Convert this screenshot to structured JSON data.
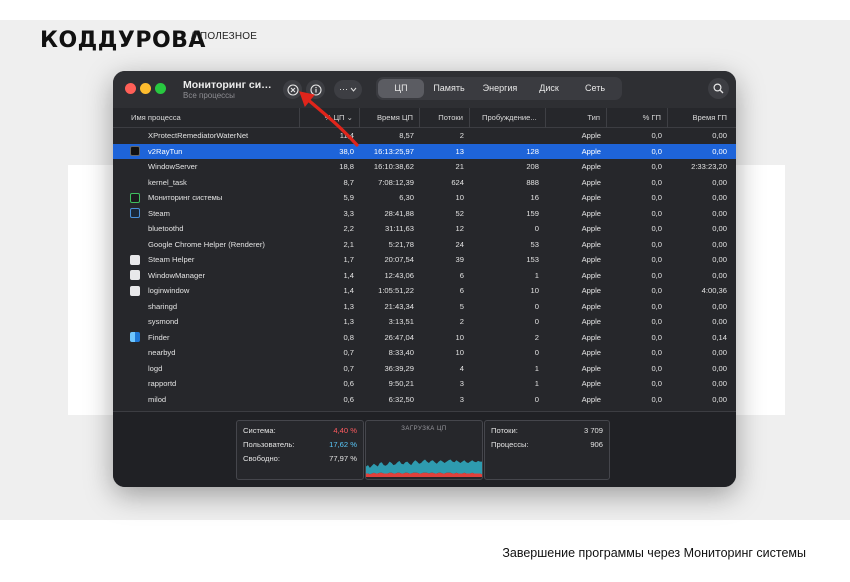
{
  "page": {
    "logo": "КОДДУРОВА",
    "logo_sub": "// ПОЛЕЗНОЕ",
    "caption": "Завершение программы через Мониторинг системы"
  },
  "window": {
    "title": "Мониторинг систе...",
    "subtitle": "Все процессы",
    "more_label": "⋯",
    "tabs": [
      {
        "label": "ЦП",
        "active": true
      },
      {
        "label": "Память",
        "active": false
      },
      {
        "label": "Энергия",
        "active": false
      },
      {
        "label": "Диск",
        "active": false
      },
      {
        "label": "Сеть",
        "active": false
      }
    ],
    "columns": [
      "Имя процесса",
      "% ЦП ⌄",
      "Время ЦП",
      "Потоки",
      "Пробуждение...",
      "Тип",
      "% ГП",
      "Время ГП"
    ]
  },
  "processes": [
    {
      "name": "XProtectRemediatorWaterNet",
      "cpu": "11,4",
      "time": "8,57",
      "threads": "2",
      "wakeups": "",
      "type": "Apple",
      "gpu": "0,0",
      "gpu_time": "0,00",
      "icon": "none"
    },
    {
      "name": "v2RayTun",
      "cpu": "38,0",
      "time": "16:13:25,97",
      "threads": "13",
      "wakeups": "128",
      "type": "Apple",
      "gpu": "0,0",
      "gpu_time": "0,00",
      "icon": "v2raytun-icon",
      "selected": true
    },
    {
      "name": "WindowServer",
      "cpu": "18,8",
      "time": "16:10:38,62",
      "threads": "21",
      "wakeups": "208",
      "type": "Apple",
      "gpu": "0,0",
      "gpu_time": "2:33:23,20",
      "icon": "none"
    },
    {
      "name": "kernel_task",
      "cpu": "8,7",
      "time": "7:08:12,39",
      "threads": "624",
      "wakeups": "888",
      "type": "Apple",
      "gpu": "0,0",
      "gpu_time": "0,00",
      "icon": "none"
    },
    {
      "name": "Мониторинг системы",
      "cpu": "5,9",
      "time": "6,30",
      "threads": "10",
      "wakeups": "16",
      "type": "Apple",
      "gpu": "0,0",
      "gpu_time": "0,00",
      "icon": "activity-monitor-icon"
    },
    {
      "name": "Steam",
      "cpu": "3,3",
      "time": "28:41,88",
      "threads": "52",
      "wakeups": "159",
      "type": "Apple",
      "gpu": "0,0",
      "gpu_time": "0,00",
      "icon": "steam-icon"
    },
    {
      "name": "bluetoothd",
      "cpu": "2,2",
      "time": "31:11,63",
      "threads": "12",
      "wakeups": "0",
      "type": "Apple",
      "gpu": "0,0",
      "gpu_time": "0,00",
      "icon": "none"
    },
    {
      "name": "Google Chrome Helper (Renderer)",
      "cpu": "2,1",
      "time": "5:21,78",
      "threads": "24",
      "wakeups": "53",
      "type": "Apple",
      "gpu": "0,0",
      "gpu_time": "0,00",
      "icon": "none"
    },
    {
      "name": "Steam Helper",
      "cpu": "1,7",
      "time": "20:07,54",
      "threads": "39",
      "wakeups": "153",
      "type": "Apple",
      "gpu": "0,0",
      "gpu_time": "0,00",
      "icon": "generic-app-icon"
    },
    {
      "name": "WindowManager",
      "cpu": "1,4",
      "time": "12:43,06",
      "threads": "6",
      "wakeups": "1",
      "type": "Apple",
      "gpu": "0,0",
      "gpu_time": "0,00",
      "icon": "generic-app-icon"
    },
    {
      "name": "loginwindow",
      "cpu": "1,4",
      "time": "1:05:51,22",
      "threads": "6",
      "wakeups": "10",
      "type": "Apple",
      "gpu": "0,0",
      "gpu_time": "4:00,36",
      "icon": "generic-app-icon"
    },
    {
      "name": "sharingd",
      "cpu": "1,3",
      "time": "21:43,34",
      "threads": "5",
      "wakeups": "0",
      "type": "Apple",
      "gpu": "0,0",
      "gpu_time": "0,00",
      "icon": "none"
    },
    {
      "name": "sysmond",
      "cpu": "1,3",
      "time": "3:13,51",
      "threads": "2",
      "wakeups": "0",
      "type": "Apple",
      "gpu": "0,0",
      "gpu_time": "0,00",
      "icon": "none"
    },
    {
      "name": "Finder",
      "cpu": "0,8",
      "time": "26:47,04",
      "threads": "10",
      "wakeups": "2",
      "type": "Apple",
      "gpu": "0,0",
      "gpu_time": "0,14",
      "icon": "finder-icon"
    },
    {
      "name": "nearbyd",
      "cpu": "0,7",
      "time": "8:33,40",
      "threads": "10",
      "wakeups": "0",
      "type": "Apple",
      "gpu": "0,0",
      "gpu_time": "0,00",
      "icon": "none"
    },
    {
      "name": "logd",
      "cpu": "0,7",
      "time": "36:39,29",
      "threads": "4",
      "wakeups": "1",
      "type": "Apple",
      "gpu": "0,0",
      "gpu_time": "0,00",
      "icon": "none"
    },
    {
      "name": "rapportd",
      "cpu": "0,6",
      "time": "9:50,21",
      "threads": "3",
      "wakeups": "1",
      "type": "Apple",
      "gpu": "0,0",
      "gpu_time": "0,00",
      "icon": "none"
    },
    {
      "name": "milod",
      "cpu": "0,6",
      "time": "6:32,50",
      "threads": "3",
      "wakeups": "0",
      "type": "Apple",
      "gpu": "0,0",
      "gpu_time": "0,00",
      "icon": "none"
    }
  ],
  "summary": {
    "system_label": "Система:",
    "system_value": "4,40 %",
    "system_color": "#ff5a5f",
    "user_label": "Пользователь:",
    "user_value": "17,62 %",
    "user_color": "#5ac8fa",
    "idle_label": "Свободно:",
    "idle_value": "77,97 %",
    "chart_title": "ЗАГРУЗКА ЦП",
    "threads_label": "Потоки:",
    "threads_value": "3 709",
    "processes_label": "Процессы:",
    "processes_value": "906"
  },
  "cpu_load_history": {
    "user": [
      0.1,
      0.12,
      0.09,
      0.11,
      0.13,
      0.12,
      0.1,
      0.14,
      0.15,
      0.12,
      0.11,
      0.13,
      0.16,
      0.14,
      0.12,
      0.13,
      0.15,
      0.17,
      0.14,
      0.13,
      0.15,
      0.16,
      0.14,
      0.12,
      0.15,
      0.18,
      0.16,
      0.14,
      0.15,
      0.17,
      0.19,
      0.16,
      0.15,
      0.17,
      0.18,
      0.16,
      0.14,
      0.16,
      0.18,
      0.17,
      0.15,
      0.16,
      0.18,
      0.19,
      0.17,
      0.16,
      0.18,
      0.17,
      0.15,
      0.17,
      0.18,
      0.16,
      0.15,
      0.17,
      0.18,
      0.17,
      0.16,
      0.18,
      0.17,
      0.18
    ],
    "system": [
      0.05,
      0.05,
      0.04,
      0.05,
      0.06,
      0.05,
      0.05,
      0.06,
      0.06,
      0.05,
      0.05,
      0.05,
      0.06,
      0.06,
      0.05,
      0.05,
      0.06,
      0.06,
      0.05,
      0.05,
      0.06,
      0.06,
      0.05,
      0.05,
      0.06,
      0.06,
      0.06,
      0.05,
      0.05,
      0.06,
      0.06,
      0.06,
      0.05,
      0.06,
      0.06,
      0.05,
      0.05,
      0.06,
      0.06,
      0.05,
      0.05,
      0.06,
      0.06,
      0.06,
      0.05,
      0.05,
      0.06,
      0.05,
      0.05,
      0.05,
      0.06,
      0.05,
      0.05,
      0.05,
      0.06,
      0.05,
      0.05,
      0.05,
      0.05,
      0.04
    ],
    "user_color": "#30b0c7",
    "system_color": "#e0413c"
  },
  "annotation": {
    "arrow_color": "#e0251b"
  }
}
